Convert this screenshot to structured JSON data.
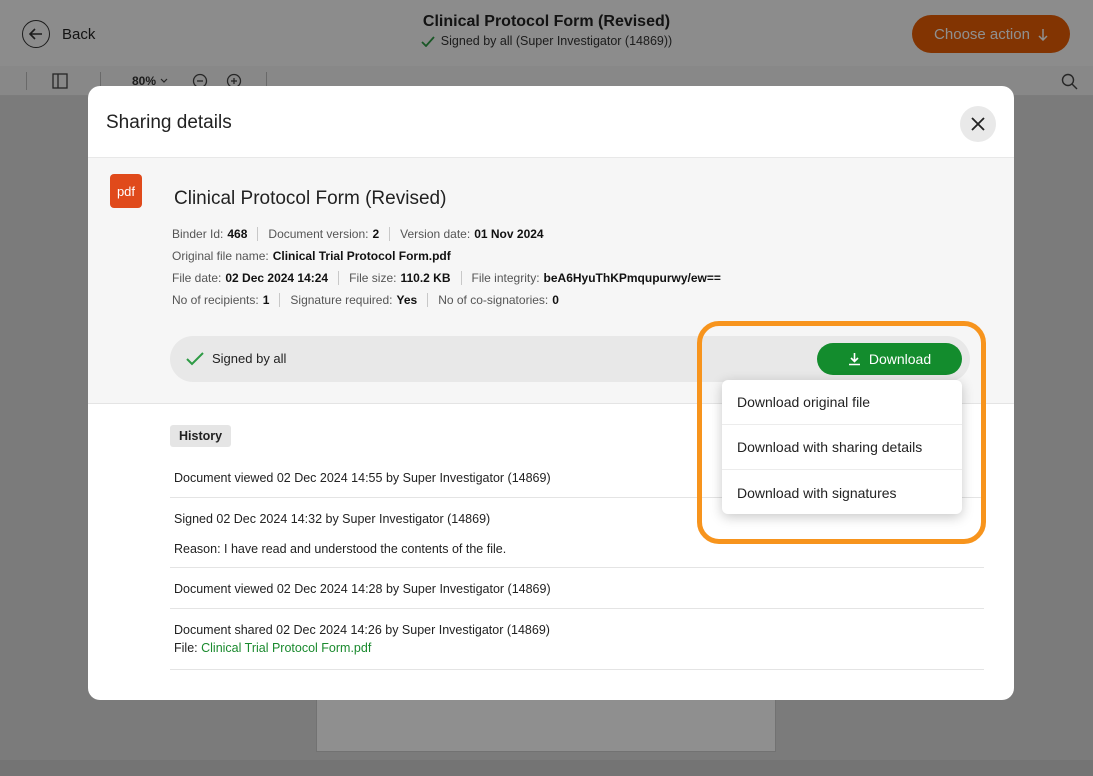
{
  "app": {
    "back_label": "Back",
    "doc_title": "Clinical Protocol Form (Revised)",
    "doc_status": "Signed by all (Super Investigator (14869))",
    "choose_action_label": "Choose action",
    "zoom_level": "80%",
    "colors": {
      "accent_orange": "#e85d04",
      "green": "#138c2d",
      "highlight": "#f7941d"
    }
  },
  "modal": {
    "title": "Sharing details",
    "file_type_badge": "pdf",
    "file_title": "Clinical Protocol Form (Revised)",
    "meta": {
      "binder_id_label": "Binder Id:",
      "binder_id": "468",
      "doc_version_label": "Document version:",
      "doc_version": "2",
      "version_date_label": "Version date:",
      "version_date": "01 Nov 2024",
      "original_name_label": "Original file name:",
      "original_name": "Clinical Trial Protocol Form.pdf",
      "file_date_label": "File date:",
      "file_date": "02 Dec 2024 14:24",
      "file_size_label": "File size:",
      "file_size": "110.2 KB",
      "integrity_label": "File integrity:",
      "integrity": "beA6HyuThKPmqupurwy/ew==",
      "recipients_label": "No of recipients:",
      "recipients": "1",
      "sig_required_label": "Signature required:",
      "sig_required": "Yes",
      "cosign_label": "No of co-signatories:",
      "cosign": "0"
    },
    "signed_status": "Signed by all",
    "download_label": "Download",
    "download_menu": [
      "Download original file",
      "Download with sharing details",
      "Download with signatures"
    ],
    "history_label": "History",
    "history": [
      {
        "line1": "Document viewed 02 Dec 2024 14:55 by Super Investigator (14869)"
      },
      {
        "line1": "Signed 02 Dec 2024 14:32 by Super Investigator (14869)",
        "line2": "Reason: I have read and understood the contents of the file."
      },
      {
        "line1": "Document viewed 02 Dec 2024 14:28 by Super Investigator (14869)"
      },
      {
        "line1": "Document shared 02 Dec 2024 14:26 by Super Investigator (14869)",
        "file_label": "File:",
        "file_name": "Clinical Trial Protocol Form.pdf"
      }
    ]
  }
}
